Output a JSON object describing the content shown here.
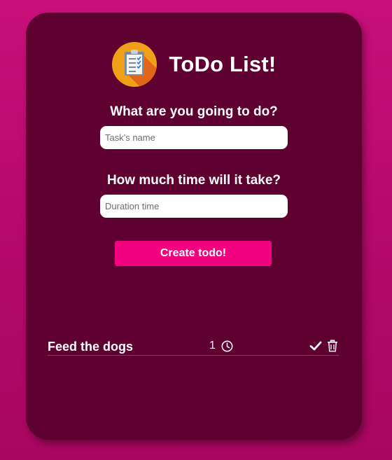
{
  "app": {
    "title": "ToDo List!",
    "logo_icon": "clipboard-checklist-icon"
  },
  "form": {
    "task_label": "What are you going to do?",
    "task_placeholder": "Task's name",
    "task_value": "",
    "duration_label": "How much time will it take?",
    "duration_placeholder": "Duration time",
    "duration_value": "",
    "create_button_label": "Create todo!"
  },
  "todos": [
    {
      "name": "Feed the dogs",
      "duration": "1",
      "time_icon": "clock-icon",
      "actions": [
        "check-icon",
        "trash-icon"
      ]
    }
  ],
  "colors": {
    "background": "#c80f7a",
    "card": "#5e0030",
    "accent": "#f2027f",
    "logo": "#f0a018",
    "divider": "#d4156e"
  }
}
